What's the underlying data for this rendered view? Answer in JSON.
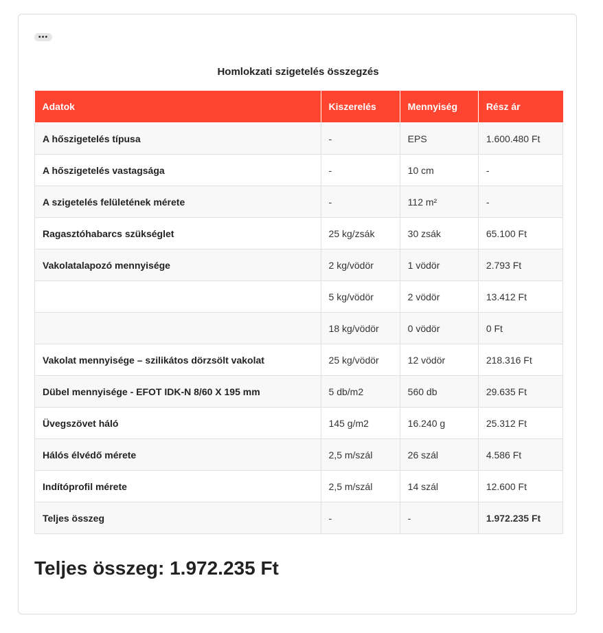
{
  "more_button": "•••",
  "title": "Homlokzati szigetelés összegzés",
  "headers": [
    "Adatok",
    "Kiszerelés",
    "Mennyiség",
    "Rész ár"
  ],
  "rows": [
    [
      "A hőszigetelés típusa",
      "-",
      "EPS",
      "1.600.480 Ft"
    ],
    [
      "A hőszigetelés vastagsága",
      "-",
      "10 cm",
      "-"
    ],
    [
      "A szigetelés felületének mérete",
      "-",
      "112 m²",
      "-"
    ],
    [
      "Ragasztóhabarcs szükséglet",
      "25 kg/zsák",
      "30 zsák",
      "65.100 Ft"
    ],
    [
      "Vakolatalapozó mennyisége",
      "2 kg/vödör",
      "1 vödör",
      "2.793 Ft"
    ],
    [
      "",
      "5 kg/vödör",
      "2 vödör",
      "13.412 Ft"
    ],
    [
      "",
      "18 kg/vödör",
      "0 vödör",
      "0 Ft"
    ],
    [
      "Vakolat mennyisége – szilikátos dörzsölt vakolat",
      "25 kg/vödör",
      "12 vödör",
      "218.316 Ft"
    ],
    [
      "Dübel mennyisége - EFOT IDK-N 8/60 X 195 mm",
      "5 db/m2",
      "560 db",
      "29.635 Ft"
    ],
    [
      "Üvegszövet háló",
      "145 g/m2",
      "16.240 g",
      "25.312 Ft"
    ],
    [
      "Hálós élvédő mérete",
      "2,5 m/szál",
      "26 szál",
      "4.586 Ft"
    ],
    [
      "Indítóprofil mérete",
      "2,5 m/szál",
      "14 szál",
      "12.600 Ft"
    ],
    [
      "Teljes összeg",
      "-",
      "-",
      "1.972.235 Ft"
    ]
  ],
  "grand_total": "Teljes összeg: 1.972.235 Ft",
  "colors": {
    "header_bg": "#ff4530",
    "stripe_bg": "#f8f8f8"
  }
}
